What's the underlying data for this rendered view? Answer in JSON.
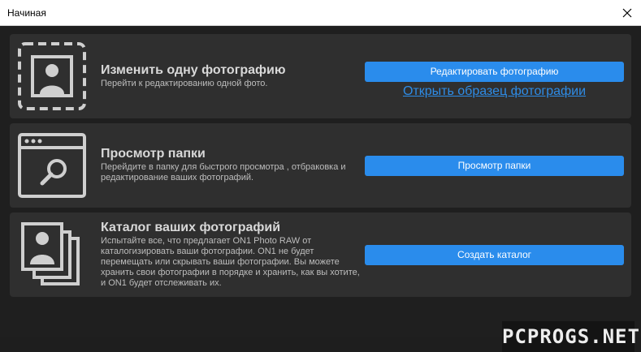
{
  "window": {
    "title": "Начиная"
  },
  "panels": [
    {
      "title": "Изменить одну фотографию",
      "description": "Перейти к редактированию одной фото.",
      "button": "Редактировать фотографию",
      "link": "Открыть образец фотографии",
      "icon": "single-photo-icon"
    },
    {
      "title": "Просмотр папки",
      "description": "Перейдите в папку для быстрого просмотра , отбраковка и\nредактирование ваших фотографий.",
      "button": "Просмотр папки",
      "icon": "browse-folder-icon"
    },
    {
      "title": "Каталог ваших фотографий",
      "description": "Испытайте все, что предлагает ON1 Photo RAW от\nкаталогизировать ваши фотографии. ON1 не будет\nперемещать или скрывать ваши фотографии. Вы можете\nхранить свои фотографии в порядке и хранить, как вы хотите,\nи ON1 будет отслеживать их.",
      "button": "Создать каталог",
      "icon": "photo-catalog-icon"
    }
  ],
  "watermark": "PCPROGS.NET",
  "colors": {
    "accent": "#2a8cec",
    "panel": "#2f2f2f",
    "background": "#1f1f1f"
  }
}
